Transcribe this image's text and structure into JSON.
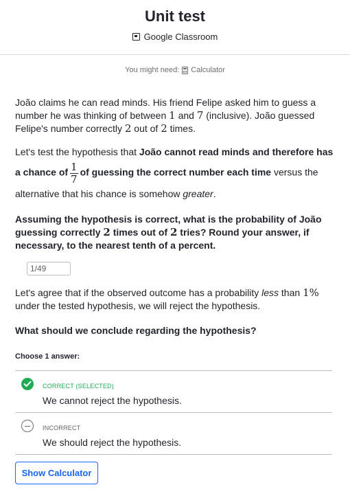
{
  "header": {
    "title": "Unit test",
    "source": "Google Classroom"
  },
  "tools": {
    "prefix": "You might need:",
    "calculator": "Calculator"
  },
  "question": {
    "p1_a": "João claims he can read minds. His friend Felipe asked him to guess a number he was thinking of between ",
    "p1_n1": "1",
    "p1_b": " and ",
    "p1_n2": "7",
    "p1_c": " (inclusive). João guessed Felipe's number correctly ",
    "p1_n3": "2",
    "p1_d": " out of ",
    "p1_n4": "2",
    "p1_e": " times.",
    "p2_a": "Let's test the hypothesis that ",
    "p2_bold1": "João cannot read minds and therefore has a chance of",
    "p2_frac_num": "1",
    "p2_frac_den": "7",
    "p2_bold2": "of guessing the correct number each time",
    "p2_b": " versus the alternative that his chance is somehow ",
    "p2_italic": "greater",
    "p2_c": ".",
    "p3_a": "Assuming the hypothesis is correct, what is the probability of João guessing correctly ",
    "p3_n1": "2",
    "p3_b": " times out of ",
    "p3_n2": "2",
    "p3_c": " tries? Round your answer, if necessary, to the nearest tenth of a percent.",
    "answer_value": "1/49",
    "p4_a": "Let's agree that if the observed outcome has a probability ",
    "p4_italic": "less",
    "p4_b": " than ",
    "p4_math": "1%",
    "p4_c": " under the tested hypothesis, we will reject the hypothesis.",
    "p5": "What should we conclude regarding the hypothesis?"
  },
  "choices": {
    "prompt": "Choose 1 answer:",
    "items": [
      {
        "status": "CORRECT (SELECTED)",
        "text": "We cannot reject the hypothesis.",
        "state": "correct"
      },
      {
        "status": "INCORRECT",
        "text": "We should reject the hypothesis.",
        "state": "incorrect"
      }
    ]
  },
  "footer": {
    "show_calculator": "Show Calculator"
  },
  "colors": {
    "correct": "#1fab54",
    "link": "#1865f2",
    "text": "#21242c"
  }
}
